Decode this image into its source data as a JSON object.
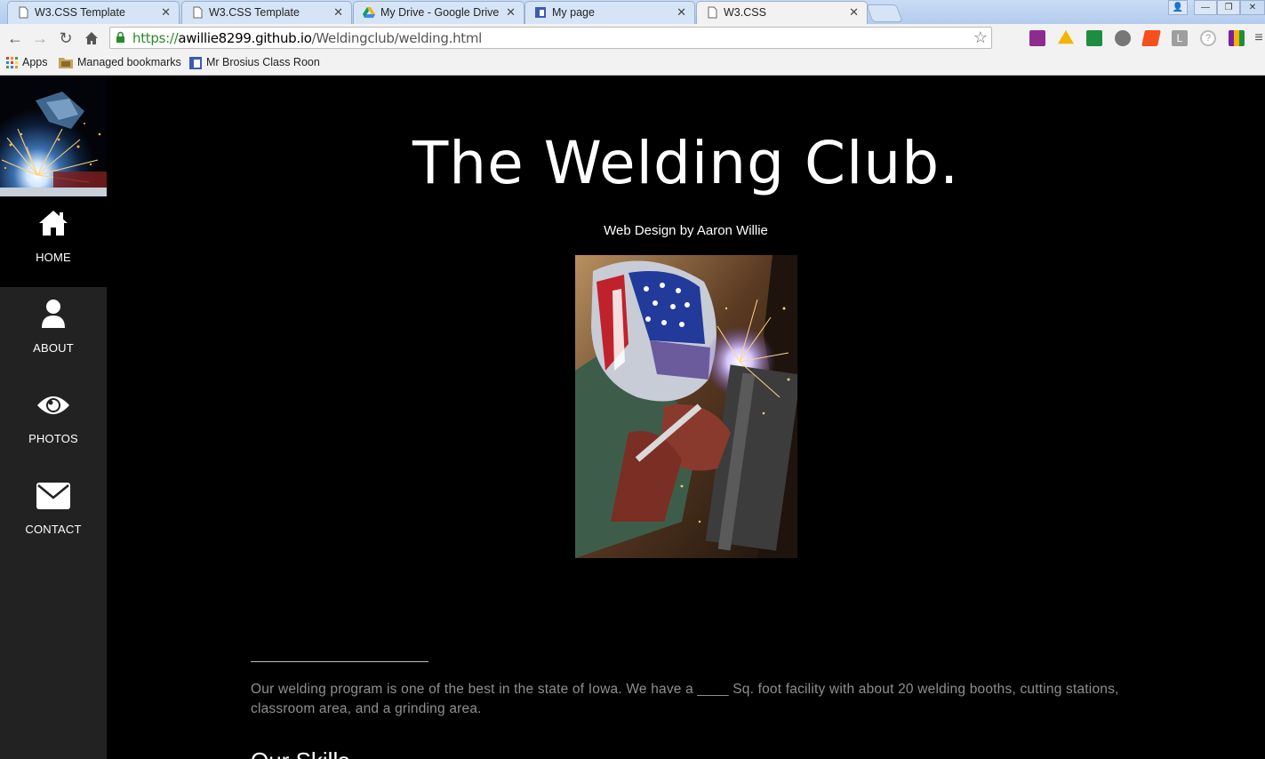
{
  "browser": {
    "tabs": [
      {
        "title": "W3.CSS Template",
        "icon": "page-icon",
        "active": false
      },
      {
        "title": "W3.CSS Template",
        "icon": "page-icon",
        "active": false
      },
      {
        "title": "My Drive - Google Drive",
        "icon": "google-drive-icon",
        "active": false
      },
      {
        "title": "My page",
        "icon": "sites-icon",
        "active": false
      },
      {
        "title": "W3.CSS",
        "icon": "page-icon",
        "active": true
      }
    ],
    "close_glyph": "✕",
    "address": {
      "scheme": "https://",
      "host": "awillie8299.github.io",
      "path": "/Weldingclub/welding.html"
    },
    "bookmarks": [
      {
        "label": "Apps",
        "icon": "apps-grid-icon"
      },
      {
        "label": "Managed bookmarks",
        "icon": "folder-icon"
      },
      {
        "label": "Mr Brosius Class Roon",
        "icon": "sites-icon"
      }
    ],
    "extension_colors": [
      "#8e2c8e",
      "#f4b400",
      "#1e8e3e",
      "#777777",
      "#f4511e",
      "#9e9e9e",
      "#9e9e9e",
      "#7b1fa2"
    ]
  },
  "sidebar": {
    "items": [
      {
        "label": "HOME",
        "icon": "home-icon",
        "active": true
      },
      {
        "label": "ABOUT",
        "icon": "user-icon",
        "active": false
      },
      {
        "label": "PHOTOS",
        "icon": "eye-icon",
        "active": false
      },
      {
        "label": "CONTACT",
        "icon": "envelope-icon",
        "active": false
      }
    ]
  },
  "main": {
    "title": "The Welding Club.",
    "subtitle": "Web Design by Aaron Willie",
    "about_text": "Our welding program is one of the best in the state of Iowa. We have a ____ Sq. foot facility with about 20 welding booths, cutting stations, classroom area, and a grinding area.",
    "skills_heading": "Our Skills"
  },
  "colors": {
    "page_bg": "#000000",
    "sidebar_bg": "#222222",
    "text": "#ffffff",
    "muted_text": "#8f8f8f"
  }
}
